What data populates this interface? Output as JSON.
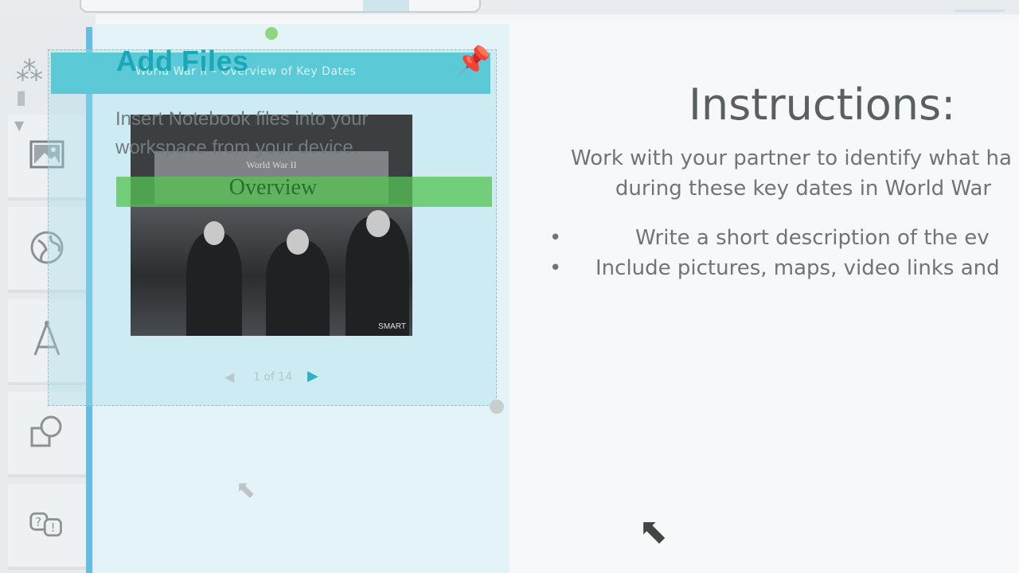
{
  "panel": {
    "title": "Add Files",
    "title_ghost": "World War II – Overview of Key Dates",
    "description": "Insert Notebook files into your workspace from your device.",
    "thumbnail_caption": "World War II",
    "thumbnail_heading": "Overview",
    "thumbnail_watermark": "SMART",
    "pager": {
      "count": "1 of 14"
    }
  },
  "rail": {
    "items": [
      {
        "icon": "image-icon"
      },
      {
        "icon": "globe-icon"
      },
      {
        "icon": "drawing-icon"
      },
      {
        "icon": "shapes-icon"
      },
      {
        "icon": "help-icon"
      }
    ]
  },
  "canvas": {
    "title": "Instructions:",
    "body_line1": "Work with your partner to identify what ha",
    "body_line2": "during these key dates in World War",
    "bullets": [
      "Write a short description of the ev",
      "Include pictures, maps, video links and"
    ]
  },
  "colors": {
    "accent": "#5bc9d6",
    "rail_stripe": "#63bfe2",
    "overview_green": "#56c454"
  }
}
